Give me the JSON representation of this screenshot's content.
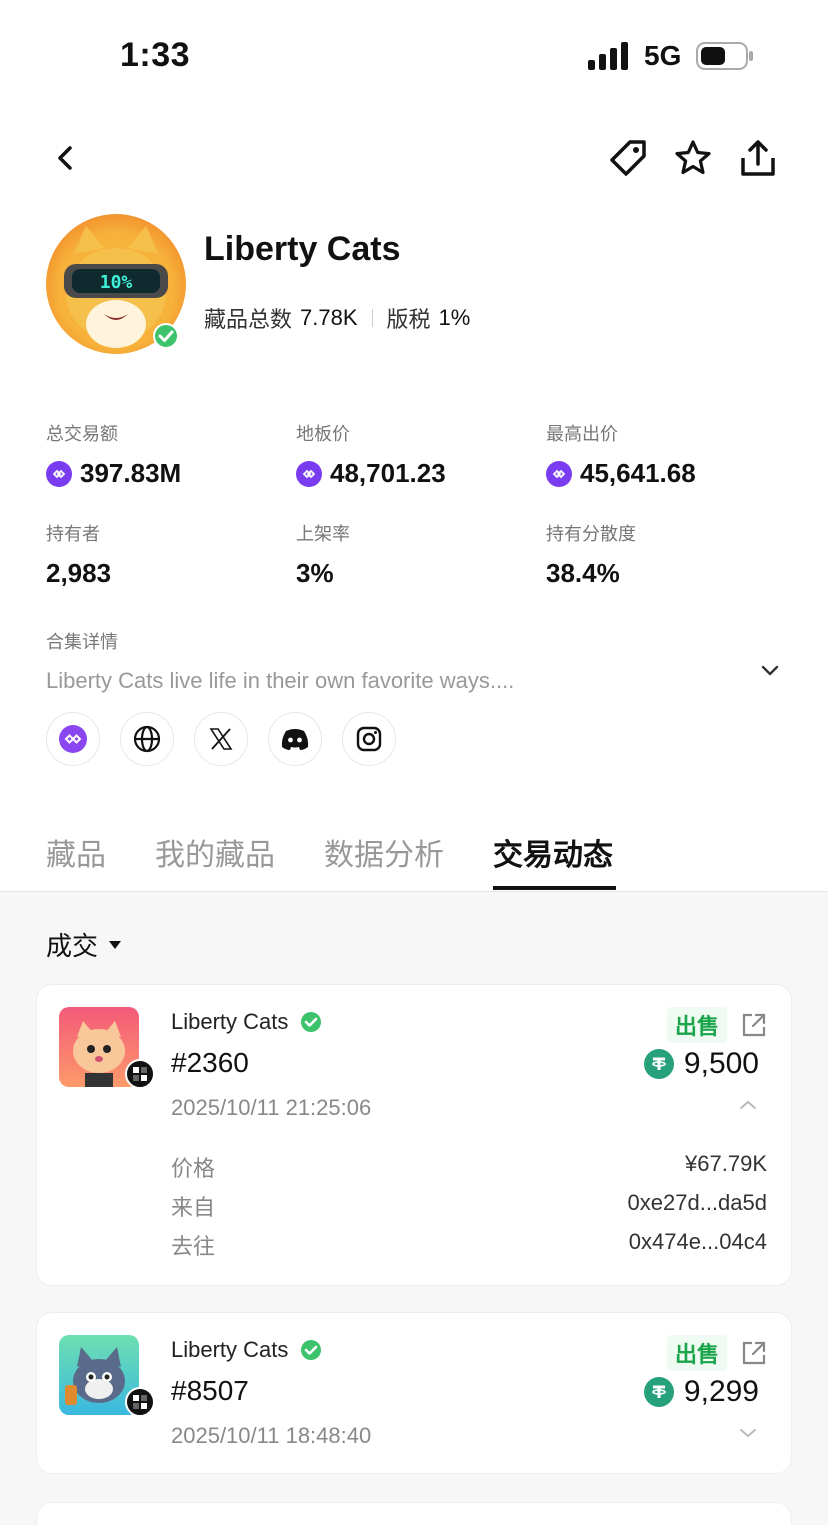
{
  "status": {
    "time": "1:33",
    "network": "5G"
  },
  "collection": {
    "name": "Liberty Cats",
    "total_label": "藏品总数",
    "total_value": "7.78K",
    "royalty_label": "版税",
    "royalty_value": "1%",
    "avatar_text": "10%"
  },
  "stats": [
    {
      "label": "总交易额",
      "value": "397.83M",
      "coin": true
    },
    {
      "label": "地板价",
      "value": "48,701.23",
      "coin": true
    },
    {
      "label": "最高出价",
      "value": "45,641.68",
      "coin": true
    },
    {
      "label": "持有者",
      "value": "2,983",
      "coin": false
    },
    {
      "label": "上架率",
      "value": "3%",
      "coin": false
    },
    {
      "label": "持有分散度",
      "value": "38.4%",
      "coin": false
    }
  ],
  "details": {
    "label": "合集详情",
    "text": "Liberty Cats live life in their own favorite ways...."
  },
  "socials": [
    "polygon-icon",
    "globe-icon",
    "x-icon",
    "discord-icon",
    "instagram-icon"
  ],
  "tabs": [
    {
      "label": "藏品",
      "active": false
    },
    {
      "label": "我的藏品",
      "active": false
    },
    {
      "label": "数据分析",
      "active": false
    },
    {
      "label": "交易动态",
      "active": true
    }
  ],
  "filter": {
    "label": "成交"
  },
  "trades": [
    {
      "collection": "Liberty Cats",
      "token_id": "#2360",
      "time": "2025/10/11 21:25:06",
      "type": "出售",
      "price": "9,500",
      "expanded": true,
      "details": [
        {
          "k": "价格",
          "v": "¥67.79K"
        },
        {
          "k": "来自",
          "v": "0xe27d...da5d"
        },
        {
          "k": "去往",
          "v": "0x474e...04c4"
        }
      ]
    },
    {
      "collection": "Liberty Cats",
      "token_id": "#8507",
      "time": "2025/10/11 18:48:40",
      "type": "出售",
      "price": "9,299",
      "expanded": false
    }
  ],
  "colors": {
    "accent_green": "#1aa54a",
    "polygon": "#7a3cf0",
    "usdt": "#26a17b"
  }
}
